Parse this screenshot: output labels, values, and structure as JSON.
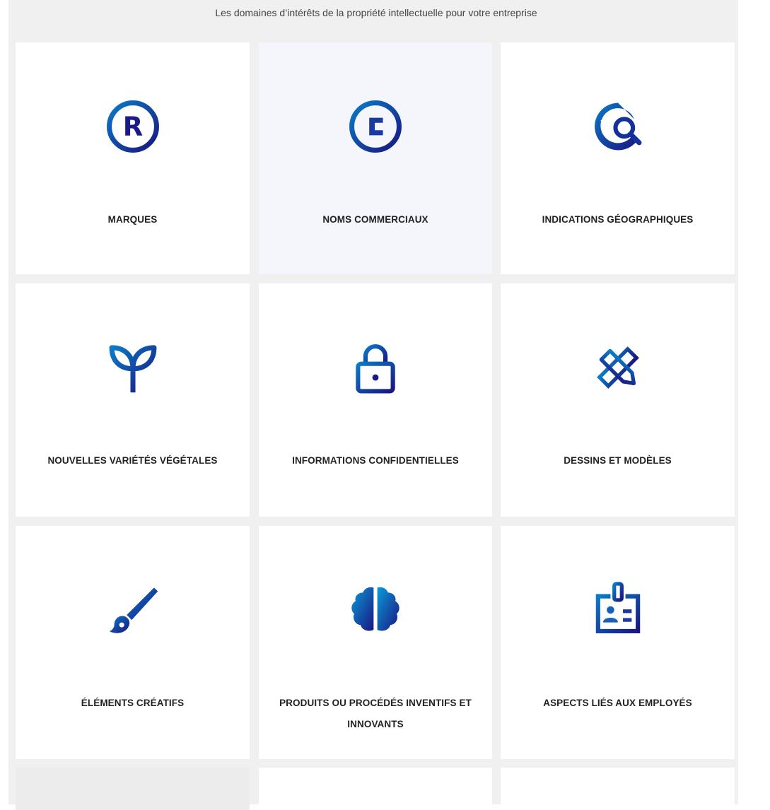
{
  "intro": "Les domaines d’intérêts de la propriété intellectuelle pour votre entreprise",
  "colors": {
    "gradient_start": "#0a7bc8",
    "gradient_end": "#1a1580",
    "tile_background": "#ffffff",
    "active_tile_background": "#f4f6fb",
    "page_background": "#f0f0f0"
  },
  "tiles": [
    {
      "label": "MARQUES",
      "icon": "registered-trademark-icon"
    },
    {
      "label": "NOMS COMMERCIAUX",
      "icon": "copyright-icon",
      "active": true
    },
    {
      "label": "INDICATIONS GÉOGRAPHIQUES",
      "icon": "globe-search-icon"
    },
    {
      "label": "NOUVELLES VARIÉTÉS VÉGÉTALES",
      "icon": "sprout-icon"
    },
    {
      "label": "INFORMATIONS CONFIDENTIELLES",
      "icon": "padlock-icon"
    },
    {
      "label": "DESSINS ET MODÈLES",
      "icon": "pencil-ruler-icon"
    },
    {
      "label": "ÉLÉMENTS CRÉATIFS",
      "icon": "paintbrush-icon"
    },
    {
      "label": "PRODUITS OU PROCÉDÉS INVENTIFS ET INNOVANTS",
      "icon": "brain-icon"
    },
    {
      "label": "ASPECTS LIÉS AUX EMPLOYÉS",
      "icon": "id-badge-icon"
    }
  ]
}
